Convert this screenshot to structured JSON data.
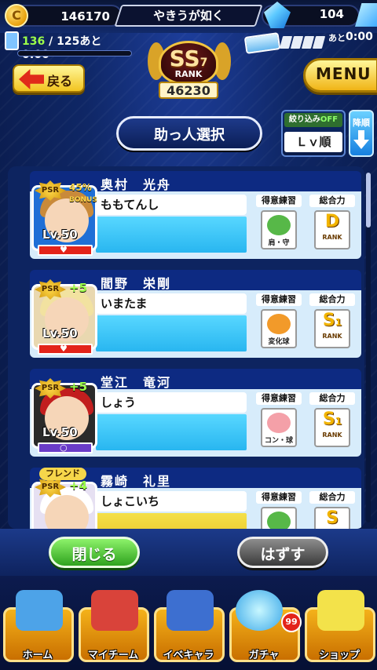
{
  "status": {
    "coins": "146170",
    "coin_icon": "C",
    "title": "やきうが如く",
    "gems": "104",
    "stamina_current": "136",
    "stamina_rest": "/ 125あと",
    "stamina_time": "0:00",
    "ticket_next_label": "あと",
    "ticket_time": "0:00"
  },
  "rank": {
    "grade": "SS",
    "level": "7",
    "label": "RANK",
    "score": "46230"
  },
  "nav": {
    "back": "戻る",
    "menu": "MENU"
  },
  "header": {
    "title": "助っ人選択",
    "filter_label": "絞り込み",
    "filter_state": "OFF",
    "sort_by": "Ｌｖ順",
    "sort_dir": "降順"
  },
  "columns": {
    "skill": "得意練習",
    "power": "総合力",
    "rank_word": "RANK"
  },
  "helpers": [
    {
      "name": "奥村　光舟",
      "nickname": "ももてんし",
      "psr": "PSR",
      "bonus": "45%",
      "bonus_word": "BONUS",
      "level": "Lv.50",
      "skill": "肩・守",
      "rank": "D",
      "rank_num": "",
      "marker": "heart"
    },
    {
      "name": "閻野　栄剛",
      "nickname": "いまたま",
      "psr": "PSR",
      "bonus": "+5",
      "bonus_word": "",
      "level": "Lv.50",
      "skill": "変化球",
      "rank": "S",
      "rank_num": "1",
      "marker": "heart"
    },
    {
      "name": "堂江　竜河",
      "nickname": "しょう",
      "psr": "PSR",
      "bonus": "+5",
      "bonus_word": "",
      "level": "Lv.50",
      "skill": "コン・球",
      "rank": "S",
      "rank_num": "1",
      "marker": "circle"
    },
    {
      "name": "霧崎　礼里",
      "nickname": "しょこいち",
      "psr": "PSR",
      "bonus": "+4",
      "bonus_word": "",
      "level": "",
      "skill": "",
      "rank": "S",
      "rank_num": "",
      "marker": "",
      "tag": "フレンド"
    }
  ],
  "actions": {
    "close": "閉じる",
    "remove": "はずす"
  },
  "tabs": [
    {
      "label": "ホーム",
      "icon": "home-icon"
    },
    {
      "label": "マイチーム",
      "icon": "team-icon"
    },
    {
      "label": "イベキャラ",
      "icon": "event-chara-icon"
    },
    {
      "label": "ガチャ",
      "icon": "gacha-icon",
      "badge": "99"
    },
    {
      "label": "ショップ",
      "icon": "shop-icon"
    }
  ],
  "colors": {
    "accent": "#f2c420",
    "card_header": "#0d2a82",
    "heart": "#e3241a"
  }
}
